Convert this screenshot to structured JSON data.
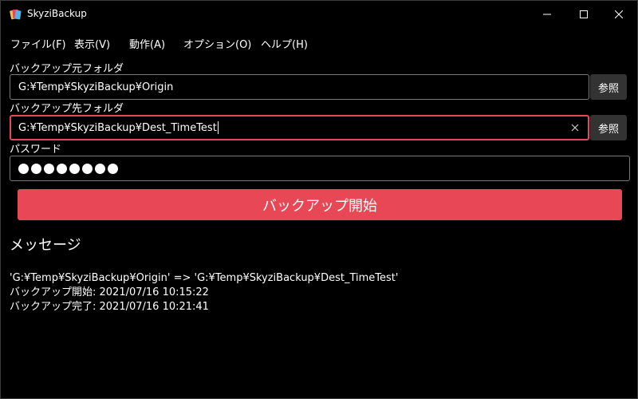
{
  "app": {
    "title": "SkyziBackup",
    "icon": "app-icon"
  },
  "menu": [
    {
      "label": "ファイル(F)"
    },
    {
      "label": "表示(V)"
    },
    {
      "label": "動作(A)"
    },
    {
      "label": "オプション(O)"
    },
    {
      "label": "ヘルプ(H)"
    }
  ],
  "source": {
    "label": "バックアップ元フォルダ",
    "value": "G:¥Temp¥SkyziBackup¥Origin",
    "browse_label": "参照"
  },
  "destination": {
    "label": "バックアップ先フォルダ",
    "value": "G:¥Temp¥SkyziBackup¥Dest_TimeTest",
    "browse_label": "参照"
  },
  "password": {
    "label": "パスワード",
    "masked_length": 8
  },
  "start_button": {
    "label": "バックアップ開始"
  },
  "messages": {
    "title": "メッセージ",
    "lines": [
      "'G:¥Temp¥SkyziBackup¥Origin' => 'G:¥Temp¥SkyziBackup¥Dest_TimeTest'",
      "バックアップ開始: 2021/07/16 10:15:22",
      "バックアップ完了: 2021/07/16 10:21:41"
    ]
  },
  "colors": {
    "accent": "#e84855",
    "background": "#000000",
    "button_bg": "#333333"
  }
}
